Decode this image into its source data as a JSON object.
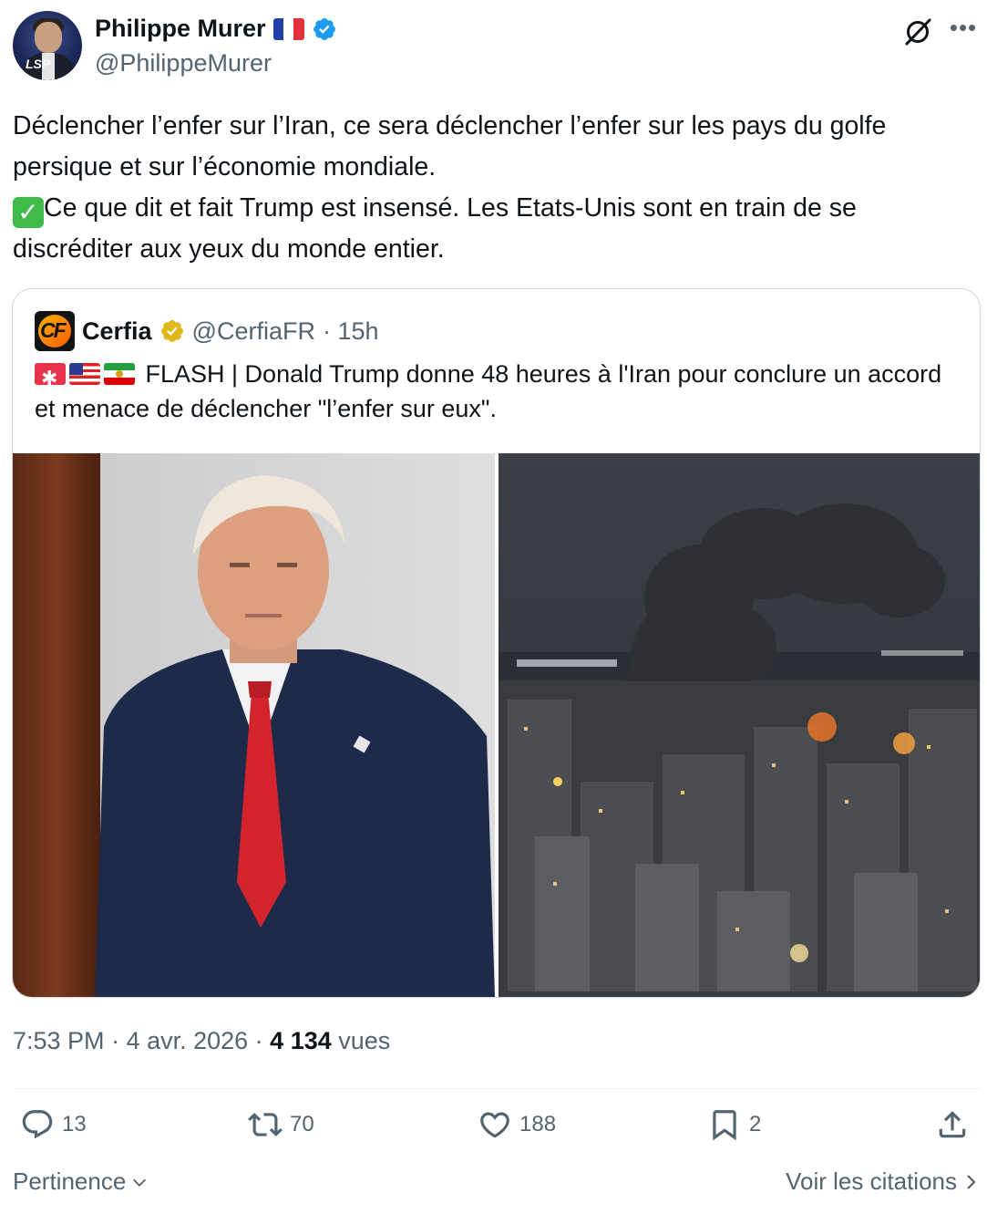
{
  "author": {
    "name": "Philippe Murer",
    "handle": "@PhilippeMurer",
    "flag_emoji": "🇫🇷",
    "verified": true,
    "verified_color": "#1d9bf0"
  },
  "tweet": {
    "line1": "Déclencher l’enfer sur l’Iran, ce sera déclencher l’enfer sur les pays du golfe persique et sur l’économie mondiale.",
    "line2_emoji": "✅",
    "line2": "Ce que dit et fait Trump est insensé. Les Etats-Unis sont en train de se discréditer aux yeux du monde entier."
  },
  "quote": {
    "name": "Cerfia",
    "handle": "@CerfiaFR",
    "time": "· 15h",
    "logo_text": "CF",
    "badge_color": "#e2b719",
    "emojis": [
      "🚨",
      "🇺🇸",
      "🇮🇷"
    ],
    "text": "FLASH | Donald Trump donne 48 heures à l'Iran pour conclure un accord et menace de déclencher \"l’enfer sur eux\".",
    "images": [
      "portrait-photo",
      "city-smoke-photo"
    ]
  },
  "meta": {
    "time": "7:53 PM",
    "sep1": " · ",
    "date": "4 avr. 2026",
    "sep2": " · ",
    "views": "4 134",
    "views_label": " vues"
  },
  "actions": {
    "replies": "13",
    "reposts": "70",
    "likes": "188",
    "bookmarks": "2"
  },
  "footer": {
    "sort_label": "Pertinence",
    "quotes_label": "Voir les citations"
  },
  "colors": {
    "text": "#0f1419",
    "secondary": "#536471",
    "border": "#cfd9de"
  }
}
